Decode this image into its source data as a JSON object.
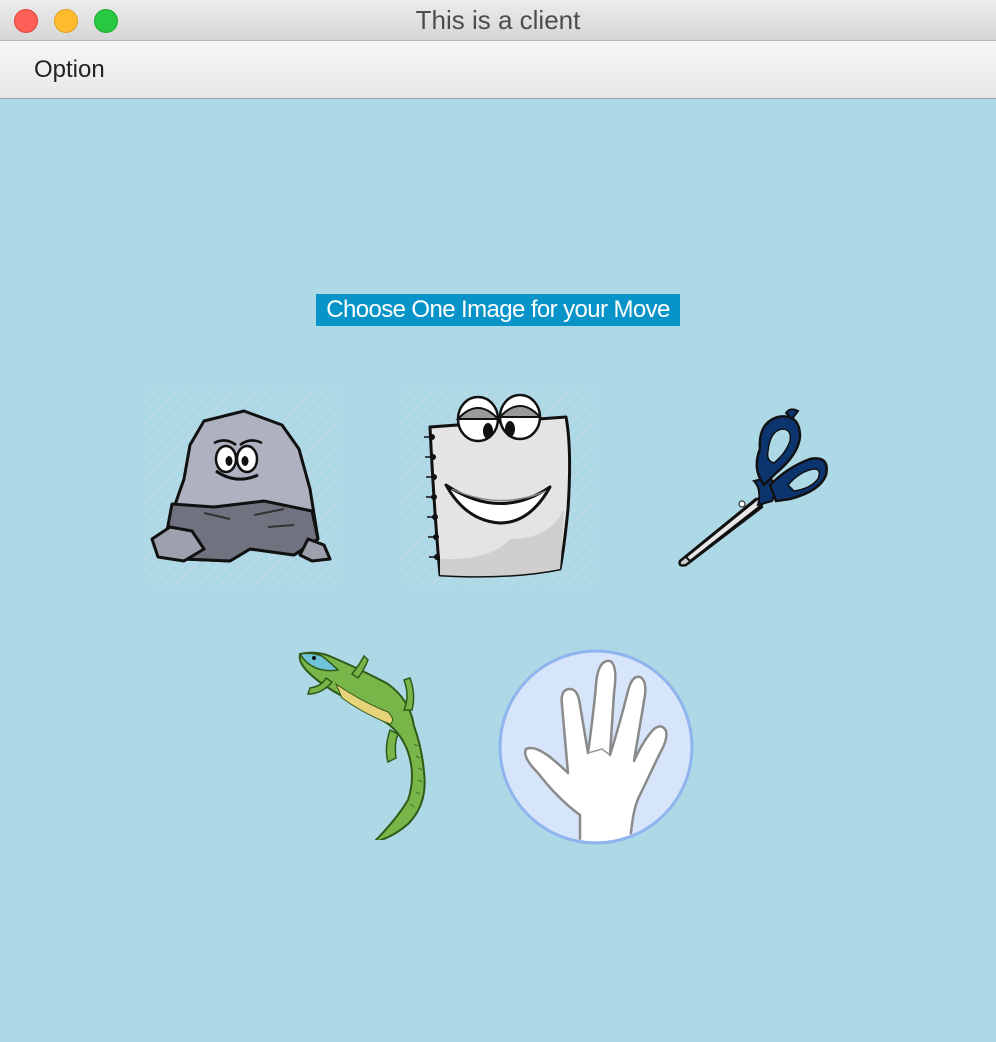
{
  "window": {
    "title": "This is a client",
    "controls": [
      "close-icon",
      "minimize-icon",
      "zoom-icon"
    ]
  },
  "menubar": {
    "items": [
      {
        "label": "Option"
      }
    ]
  },
  "main": {
    "prompt": "Choose One Image for your Move",
    "choices": [
      {
        "id": "rock",
        "icon": "rock-icon"
      },
      {
        "id": "paper",
        "icon": "paper-icon"
      },
      {
        "id": "scissors",
        "icon": "scissors-icon"
      },
      {
        "id": "lizard",
        "icon": "lizard-icon"
      },
      {
        "id": "spock",
        "icon": "spock-hand-icon"
      }
    ]
  },
  "colors": {
    "background": "#add8e6",
    "prompt_background": "#0894c8",
    "prompt_text": "#ffffff",
    "close": "#fe5f57",
    "minimize": "#febc2e",
    "zoom": "#28c840"
  }
}
